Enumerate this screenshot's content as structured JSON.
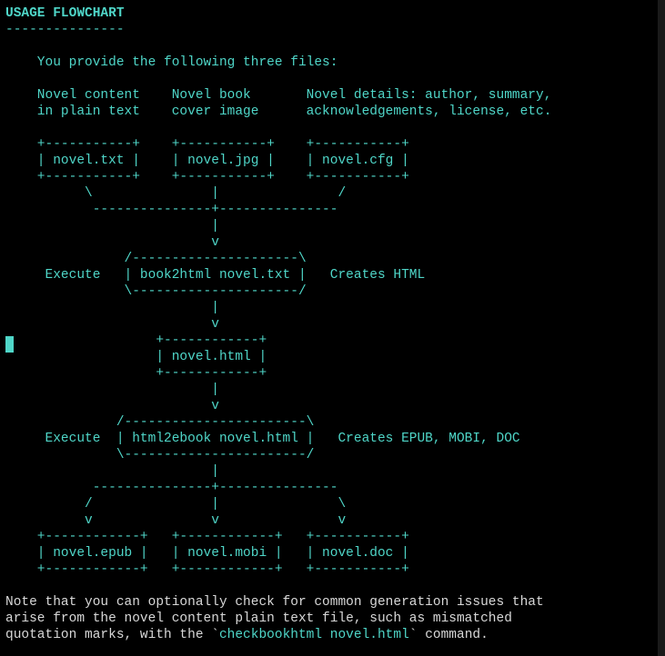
{
  "heading": "USAGE FLOWCHART",
  "diagram": "---------------\n\n    You provide the following three files:\n\n    Novel content    Novel book       Novel details: author, summary,\n    in plain text    cover image      acknowledgements, license, etc.\n\n    +-----------+    +-----------+    +-----------+\n    | novel.txt |    | novel.jpg |    | novel.cfg |\n    +-----------+    +-----------+    +-----------+\n          \\               |               /\n           ---------------+---------------\n                          |\n                          v\n               /---------------------\\\n     Execute   | book2html novel.txt |   Creates HTML\n               \\---------------------/\n                          |\n                          v\n                   +------------+\n                   | novel.html |\n                   +------------+\n                          |\n                          v\n              /-----------------------\\\n     Execute  | html2ebook novel.html |   Creates EPUB, MOBI, DOC\n              \\-----------------------/\n                          |\n           ---------------+---------------\n          /               |               \\\n          v               v               v\n    +------------+   +------------+   +-----------+\n    | novel.epub |   | novel.mobi |   | novel.doc |\n    +------------+   +------------+   +-----------+",
  "note": {
    "line1": "Note that you can optionally check for common generation issues that",
    "line2": "arise from the novel content plain text file, such as mismatched",
    "line3a": "quotation marks, with the `",
    "cmd": "checkbookhtml novel.html",
    "line3b": "` command."
  }
}
